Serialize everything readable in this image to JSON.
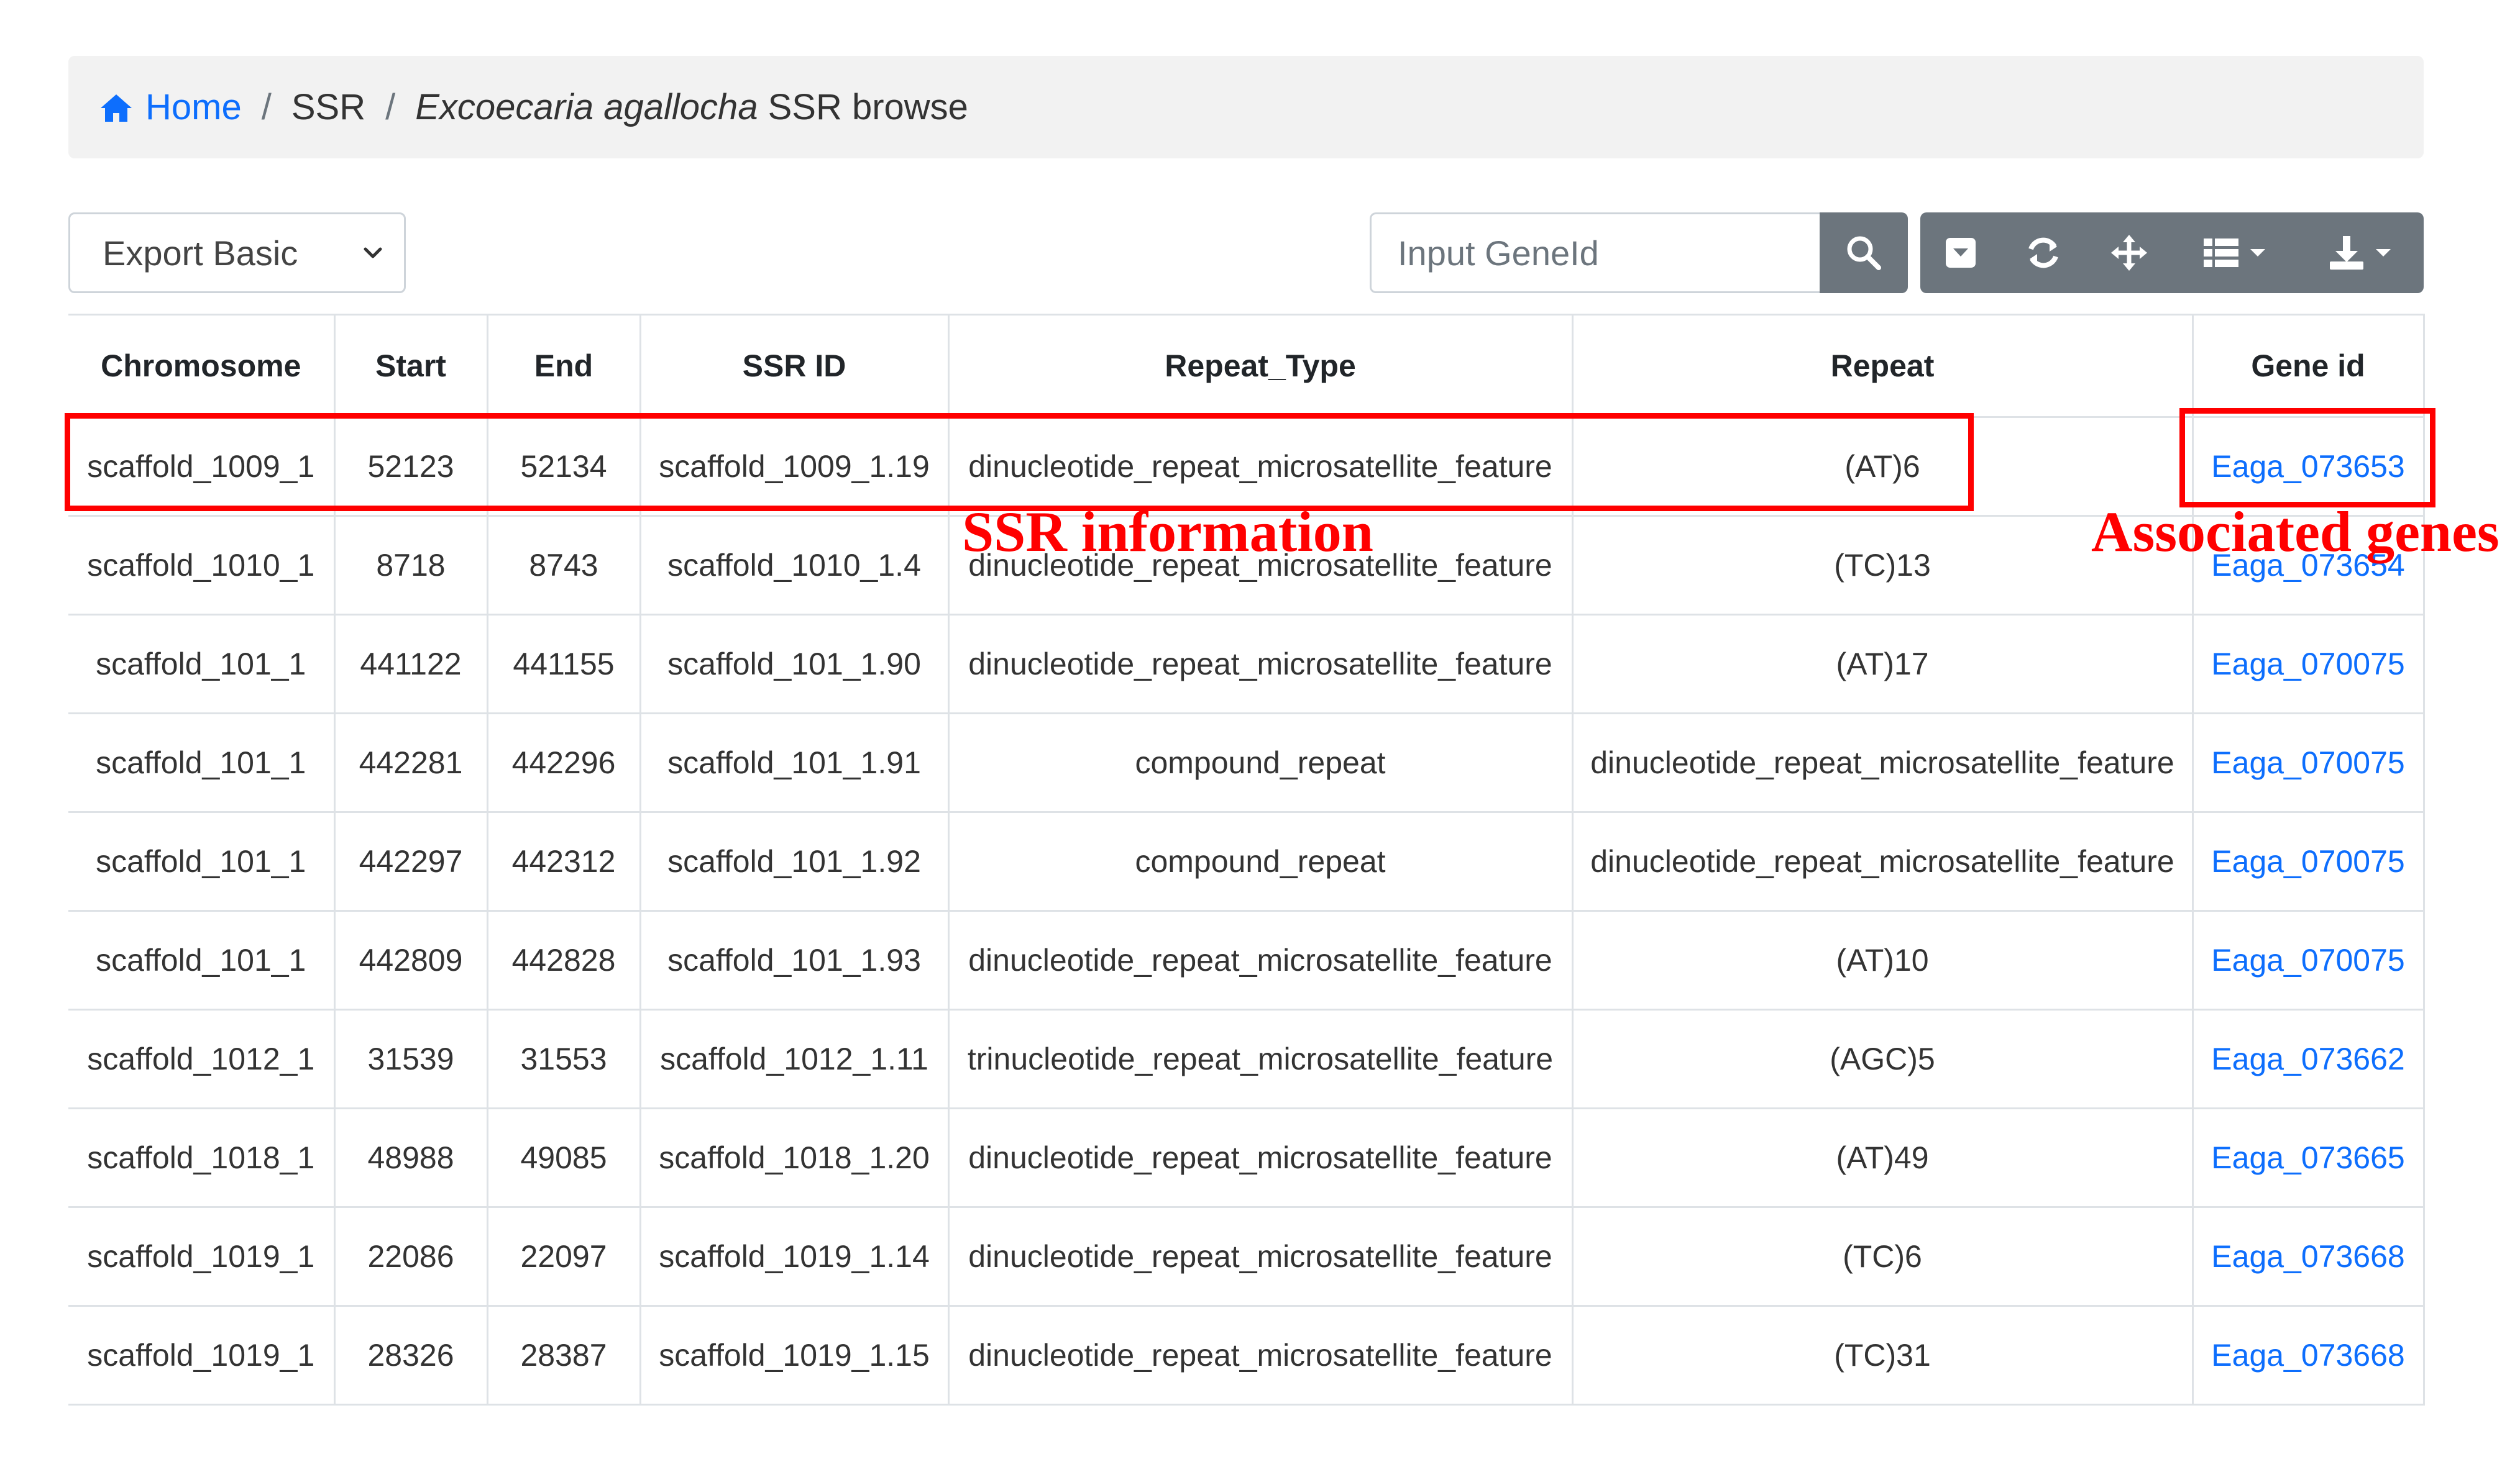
{
  "breadcrumb": {
    "home": "Home",
    "separator": "/",
    "section": "SSR",
    "species": "Excoecaria agallocha",
    "page": "SSR browse"
  },
  "toolbar": {
    "export_selected": "Export Basic",
    "search_placeholder": "Input GeneId"
  },
  "table": {
    "columns": [
      "Chromosome",
      "Start",
      "End",
      "SSR ID",
      "Repeat_Type",
      "Repeat",
      "Gene id"
    ],
    "rows": [
      [
        "scaffold_1009_1",
        "52123",
        "52134",
        "scaffold_1009_1.19",
        "dinucleotide_repeat_microsatellite_feature",
        "(AT)6",
        "Eaga_073653"
      ],
      [
        "scaffold_1010_1",
        "8718",
        "8743",
        "scaffold_1010_1.4",
        "dinucleotide_repeat_microsatellite_feature",
        "(TC)13",
        "Eaga_073654"
      ],
      [
        "scaffold_101_1",
        "441122",
        "441155",
        "scaffold_101_1.90",
        "dinucleotide_repeat_microsatellite_feature",
        "(AT)17",
        "Eaga_070075"
      ],
      [
        "scaffold_101_1",
        "442281",
        "442296",
        "scaffold_101_1.91",
        "compound_repeat",
        "dinucleotide_repeat_microsatellite_feature",
        "Eaga_070075"
      ],
      [
        "scaffold_101_1",
        "442297",
        "442312",
        "scaffold_101_1.92",
        "compound_repeat",
        "dinucleotide_repeat_microsatellite_feature",
        "Eaga_070075"
      ],
      [
        "scaffold_101_1",
        "442809",
        "442828",
        "scaffold_101_1.93",
        "dinucleotide_repeat_microsatellite_feature",
        "(AT)10",
        "Eaga_070075"
      ],
      [
        "scaffold_1012_1",
        "31539",
        "31553",
        "scaffold_1012_1.11",
        "trinucleotide_repeat_microsatellite_feature",
        "(AGC)5",
        "Eaga_073662"
      ],
      [
        "scaffold_1018_1",
        "48988",
        "49085",
        "scaffold_1018_1.20",
        "dinucleotide_repeat_microsatellite_feature",
        "(AT)49",
        "Eaga_073665"
      ],
      [
        "scaffold_1019_1",
        "22086",
        "22097",
        "scaffold_1019_1.14",
        "dinucleotide_repeat_microsatellite_feature",
        "(TC)6",
        "Eaga_073668"
      ],
      [
        "scaffold_1019_1",
        "28326",
        "28387",
        "scaffold_1019_1.15",
        "dinucleotide_repeat_microsatellite_feature",
        "(TC)31",
        "Eaga_073668"
      ]
    ]
  },
  "annotations": {
    "ssr_label": "SSR information",
    "gene_label": "Associated genes",
    "color": "#ff0000"
  },
  "colors": {
    "link": "#0d6efd",
    "button": "#6c757d",
    "breadcrumb_bg": "#f2f2f2"
  },
  "icons": {
    "home": "home-icon",
    "search": "search-icon",
    "toggle": "toggle-icon",
    "refresh": "refresh-icon",
    "fullscreen": "move-icon",
    "columns": "columns-icon",
    "export": "download-icon"
  }
}
